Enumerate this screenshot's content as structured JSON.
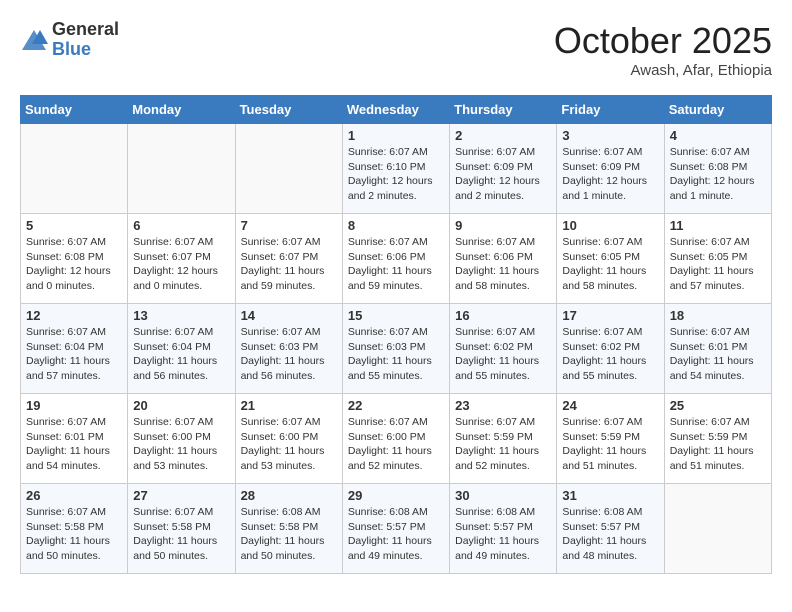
{
  "header": {
    "logo_general": "General",
    "logo_blue": "Blue",
    "month": "October 2025",
    "location": "Awash, Afar, Ethiopia"
  },
  "days_of_week": [
    "Sunday",
    "Monday",
    "Tuesday",
    "Wednesday",
    "Thursday",
    "Friday",
    "Saturday"
  ],
  "weeks": [
    [
      {
        "day": "",
        "info": ""
      },
      {
        "day": "",
        "info": ""
      },
      {
        "day": "",
        "info": ""
      },
      {
        "day": "1",
        "info": "Sunrise: 6:07 AM\nSunset: 6:10 PM\nDaylight: 12 hours\nand 2 minutes."
      },
      {
        "day": "2",
        "info": "Sunrise: 6:07 AM\nSunset: 6:09 PM\nDaylight: 12 hours\nand 2 minutes."
      },
      {
        "day": "3",
        "info": "Sunrise: 6:07 AM\nSunset: 6:09 PM\nDaylight: 12 hours\nand 1 minute."
      },
      {
        "day": "4",
        "info": "Sunrise: 6:07 AM\nSunset: 6:08 PM\nDaylight: 12 hours\nand 1 minute."
      }
    ],
    [
      {
        "day": "5",
        "info": "Sunrise: 6:07 AM\nSunset: 6:08 PM\nDaylight: 12 hours\nand 0 minutes."
      },
      {
        "day": "6",
        "info": "Sunrise: 6:07 AM\nSunset: 6:07 PM\nDaylight: 12 hours\nand 0 minutes."
      },
      {
        "day": "7",
        "info": "Sunrise: 6:07 AM\nSunset: 6:07 PM\nDaylight: 11 hours\nand 59 minutes."
      },
      {
        "day": "8",
        "info": "Sunrise: 6:07 AM\nSunset: 6:06 PM\nDaylight: 11 hours\nand 59 minutes."
      },
      {
        "day": "9",
        "info": "Sunrise: 6:07 AM\nSunset: 6:06 PM\nDaylight: 11 hours\nand 58 minutes."
      },
      {
        "day": "10",
        "info": "Sunrise: 6:07 AM\nSunset: 6:05 PM\nDaylight: 11 hours\nand 58 minutes."
      },
      {
        "day": "11",
        "info": "Sunrise: 6:07 AM\nSunset: 6:05 PM\nDaylight: 11 hours\nand 57 minutes."
      }
    ],
    [
      {
        "day": "12",
        "info": "Sunrise: 6:07 AM\nSunset: 6:04 PM\nDaylight: 11 hours\nand 57 minutes."
      },
      {
        "day": "13",
        "info": "Sunrise: 6:07 AM\nSunset: 6:04 PM\nDaylight: 11 hours\nand 56 minutes."
      },
      {
        "day": "14",
        "info": "Sunrise: 6:07 AM\nSunset: 6:03 PM\nDaylight: 11 hours\nand 56 minutes."
      },
      {
        "day": "15",
        "info": "Sunrise: 6:07 AM\nSunset: 6:03 PM\nDaylight: 11 hours\nand 55 minutes."
      },
      {
        "day": "16",
        "info": "Sunrise: 6:07 AM\nSunset: 6:02 PM\nDaylight: 11 hours\nand 55 minutes."
      },
      {
        "day": "17",
        "info": "Sunrise: 6:07 AM\nSunset: 6:02 PM\nDaylight: 11 hours\nand 55 minutes."
      },
      {
        "day": "18",
        "info": "Sunrise: 6:07 AM\nSunset: 6:01 PM\nDaylight: 11 hours\nand 54 minutes."
      }
    ],
    [
      {
        "day": "19",
        "info": "Sunrise: 6:07 AM\nSunset: 6:01 PM\nDaylight: 11 hours\nand 54 minutes."
      },
      {
        "day": "20",
        "info": "Sunrise: 6:07 AM\nSunset: 6:00 PM\nDaylight: 11 hours\nand 53 minutes."
      },
      {
        "day": "21",
        "info": "Sunrise: 6:07 AM\nSunset: 6:00 PM\nDaylight: 11 hours\nand 53 minutes."
      },
      {
        "day": "22",
        "info": "Sunrise: 6:07 AM\nSunset: 6:00 PM\nDaylight: 11 hours\nand 52 minutes."
      },
      {
        "day": "23",
        "info": "Sunrise: 6:07 AM\nSunset: 5:59 PM\nDaylight: 11 hours\nand 52 minutes."
      },
      {
        "day": "24",
        "info": "Sunrise: 6:07 AM\nSunset: 5:59 PM\nDaylight: 11 hours\nand 51 minutes."
      },
      {
        "day": "25",
        "info": "Sunrise: 6:07 AM\nSunset: 5:59 PM\nDaylight: 11 hours\nand 51 minutes."
      }
    ],
    [
      {
        "day": "26",
        "info": "Sunrise: 6:07 AM\nSunset: 5:58 PM\nDaylight: 11 hours\nand 50 minutes."
      },
      {
        "day": "27",
        "info": "Sunrise: 6:07 AM\nSunset: 5:58 PM\nDaylight: 11 hours\nand 50 minutes."
      },
      {
        "day": "28",
        "info": "Sunrise: 6:08 AM\nSunset: 5:58 PM\nDaylight: 11 hours\nand 50 minutes."
      },
      {
        "day": "29",
        "info": "Sunrise: 6:08 AM\nSunset: 5:57 PM\nDaylight: 11 hours\nand 49 minutes."
      },
      {
        "day": "30",
        "info": "Sunrise: 6:08 AM\nSunset: 5:57 PM\nDaylight: 11 hours\nand 49 minutes."
      },
      {
        "day": "31",
        "info": "Sunrise: 6:08 AM\nSunset: 5:57 PM\nDaylight: 11 hours\nand 48 minutes."
      },
      {
        "day": "",
        "info": ""
      }
    ]
  ]
}
